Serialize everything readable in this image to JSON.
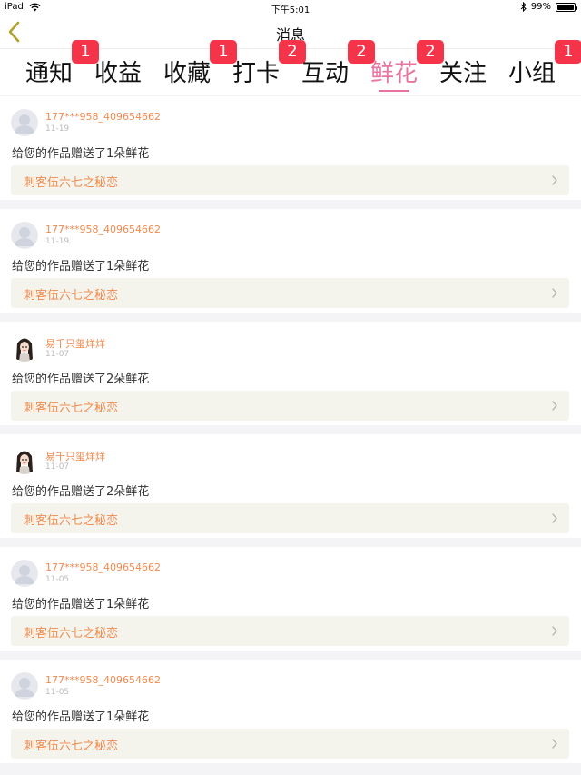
{
  "status_bar": {
    "device": "iPad",
    "time": "下午5:01",
    "battery": "99%",
    "battery_level": 0.99
  },
  "nav": {
    "title": "消息"
  },
  "tabs": [
    {
      "label": "通知",
      "badge": "1"
    },
    {
      "label": "收益",
      "badge": ""
    },
    {
      "label": "收藏",
      "badge": "1"
    },
    {
      "label": "打卡",
      "badge": "2"
    },
    {
      "label": "互动",
      "badge": "2"
    },
    {
      "label": "鲜花",
      "badge": "2"
    },
    {
      "label": "关注",
      "badge": ""
    },
    {
      "label": "小组",
      "badge": "1"
    }
  ],
  "active_tab": "鲜花",
  "colors": {
    "accent_pink": "#e8759f",
    "badge_red": "#f5344a",
    "username_orange": "#f08a4f",
    "work_link_bg": "#f4f4ec"
  },
  "notifications": [
    {
      "username": "177***958_409654662",
      "date": "11-19",
      "message": "给您的作品赠送了1朵鲜花",
      "work_title": "刺客伍六七之秘恋",
      "avatar": "default-avatar"
    },
    {
      "username": "177***958_409654662",
      "date": "11-19",
      "message": "给您的作品赠送了1朵鲜花",
      "work_title": "刺客伍六七之秘恋",
      "avatar": "default-avatar"
    },
    {
      "username": "易千只玺烊烊",
      "date": "11-07",
      "message": "给您的作品赠送了2朵鲜花",
      "work_title": "刺客伍六七之秘恋",
      "avatar": "girl-avatar"
    },
    {
      "username": "易千只玺烊烊",
      "date": "11-07",
      "message": "给您的作品赠送了2朵鲜花",
      "work_title": "刺客伍六七之秘恋",
      "avatar": "girl-avatar"
    },
    {
      "username": "177***958_409654662",
      "date": "11-05",
      "message": "给您的作品赠送了1朵鲜花",
      "work_title": "刺客伍六七之秘恋",
      "avatar": "default-avatar"
    },
    {
      "username": "177***958_409654662",
      "date": "11-05",
      "message": "给您的作品赠送了1朵鲜花",
      "work_title": "刺客伍六七之秘恋",
      "avatar": "default-avatar"
    }
  ]
}
